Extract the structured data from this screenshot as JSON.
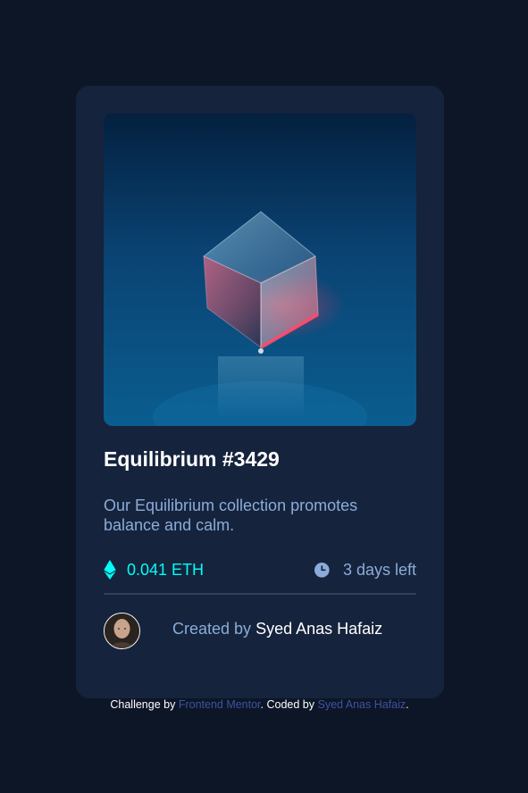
{
  "card": {
    "title": "Equilibrium #3429",
    "description": "Our Equilibrium collection promotes balance and calm.",
    "price": "0.041 ETH",
    "time_left": "3 days left",
    "creator_prefix": "Created by",
    "creator_name": "Syed Anas Hafaiz"
  },
  "footer": {
    "prefix": "Challenge by",
    "link1": "Frontend Mentor",
    "middle": ". Coded by",
    "link2": "Syed Anas Hafaiz",
    "suffix": "."
  },
  "icons": {
    "price": "ethereum-icon",
    "time": "clock-icon"
  },
  "colors": {
    "page_bg": "#0d1627",
    "card_bg": "#15233c",
    "accent_cyan": "#00fff8",
    "soft_blue": "#8bacd9",
    "divider": "#2e405a",
    "link": "#3e52a3"
  }
}
